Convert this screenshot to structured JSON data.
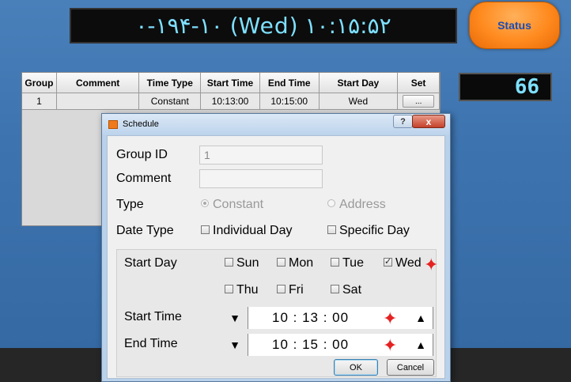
{
  "clock": {
    "text": "١٩-٠۴-١٠ (Wed) ١٠:١۵:۵٢"
  },
  "status_button": {
    "label": "Status"
  },
  "counter": {
    "value": "66"
  },
  "grid": {
    "headers": [
      "Group",
      "Comment",
      "Time Type",
      "Start Time",
      "End Time",
      "Start Day",
      "Set"
    ],
    "rows": [
      {
        "group": "1",
        "comment": "",
        "time_type": "Constant",
        "start_time": "10:13:00",
        "end_time": "10:15:00",
        "start_day": "Wed",
        "set": "..."
      }
    ]
  },
  "dialog": {
    "title": "Schedule",
    "help": "?",
    "close": "x",
    "group_id_label": "Group ID",
    "group_id_value": "1",
    "comment_label": "Comment",
    "comment_value": "",
    "type_label": "Type",
    "type_constant": "Constant",
    "type_address": "Address",
    "date_type_label": "Date Type",
    "individual_day": "Individual Day",
    "specific_day": "Specific Day",
    "start_day_label": "Start Day",
    "days": {
      "sun": "Sun",
      "mon": "Mon",
      "tue": "Tue",
      "wed": "Wed",
      "thu": "Thu",
      "fri": "Fri",
      "sat": "Sat"
    },
    "start_time_label": "Start Time",
    "start_time_value": "10 : 13 : 00",
    "end_time_label": "End Time",
    "end_time_value": "10 : 15 : 00",
    "ok": "OK",
    "cancel": "Cancel"
  },
  "colors": {
    "accent_orange": "#ff8a1e",
    "digit_cyan": "#7ee0ff",
    "marker_red": "#e52222"
  }
}
